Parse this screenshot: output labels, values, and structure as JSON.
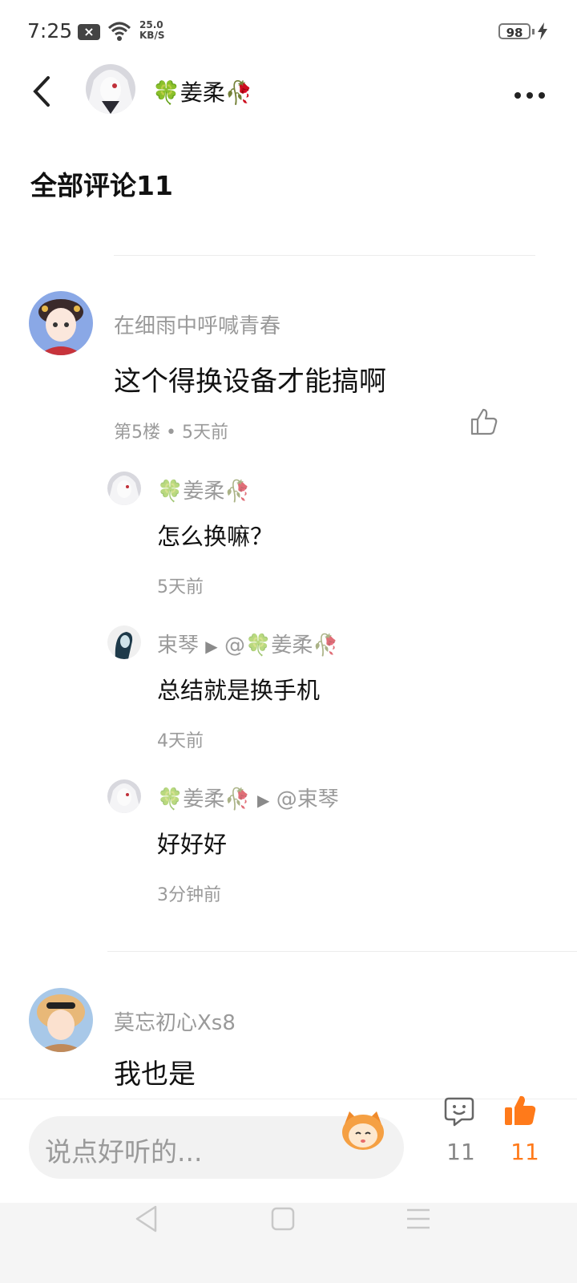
{
  "status_bar": {
    "time": "7:25",
    "speed_value": "25.0",
    "speed_unit": "KB/S",
    "battery": "98"
  },
  "header": {
    "username": "姜柔",
    "clover_glyph": "🍀",
    "rose_glyph": "🥀"
  },
  "section_title": "全部评论11",
  "comments": [
    {
      "author": "在细雨中呼喊青春",
      "text": "这个得换设备才能搞啊",
      "floor": "第5楼",
      "time": "5天前",
      "replies": [
        {
          "author": "姜柔",
          "text": "怎么换嘛？",
          "time": "5天前"
        },
        {
          "author": "束琴",
          "arrow": "▶",
          "mention": "@姜柔",
          "text": "总结就是换手机",
          "time": "4天前"
        },
        {
          "author": "姜柔",
          "arrow": "▶",
          "mention": "@束琴",
          "text": "好好好",
          "time": "3分钟前"
        }
      ]
    },
    {
      "author": "莫忘初心Xs8",
      "text": "我也是"
    }
  ],
  "bottom_bar": {
    "input_placeholder": "说点好听的...",
    "comment_count": "11",
    "like_count": "11"
  },
  "colors": {
    "accent": "#ff7a1a",
    "muted": "#9a9a9a",
    "clover": "#7bbf5a",
    "rose": "#d9534f"
  }
}
